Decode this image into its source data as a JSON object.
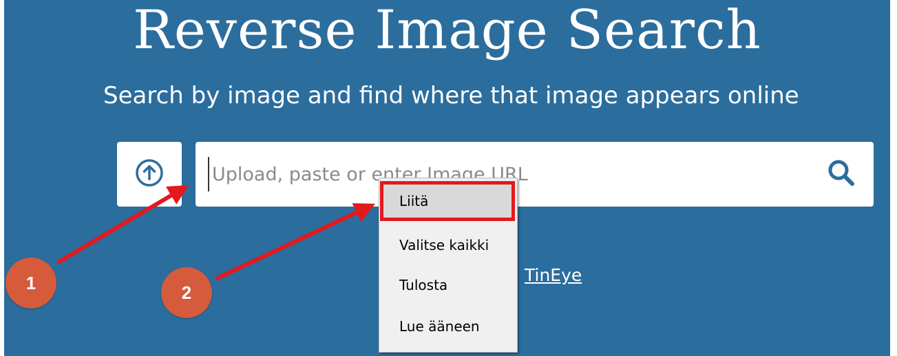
{
  "header": {
    "title": "Reverse Image Search",
    "subtitle": "Search by image and find where that image appears online"
  },
  "search": {
    "placeholder": "Upload, paste or enter Image URL",
    "value": ""
  },
  "icons": {
    "upload": "arrow-up-circle-icon",
    "search": "magnifier-icon"
  },
  "link": {
    "label": "TinEye"
  },
  "context_menu": {
    "items": [
      {
        "label": "Liitä",
        "highlighted": true
      },
      {
        "label": "Valitse kaikki",
        "highlighted": false
      },
      {
        "label": "Tulosta",
        "highlighted": false
      },
      {
        "label": "Lue ääneen",
        "highlighted": false
      }
    ]
  },
  "annotations": {
    "badge_1": "1",
    "badge_2": "2"
  },
  "colors": {
    "page_background": "#2b6d9d",
    "highlight_outline": "#e3191e",
    "arrow": "#e3191e",
    "badge": "#d65a3c",
    "icon_blue": "#2b6d9d"
  }
}
